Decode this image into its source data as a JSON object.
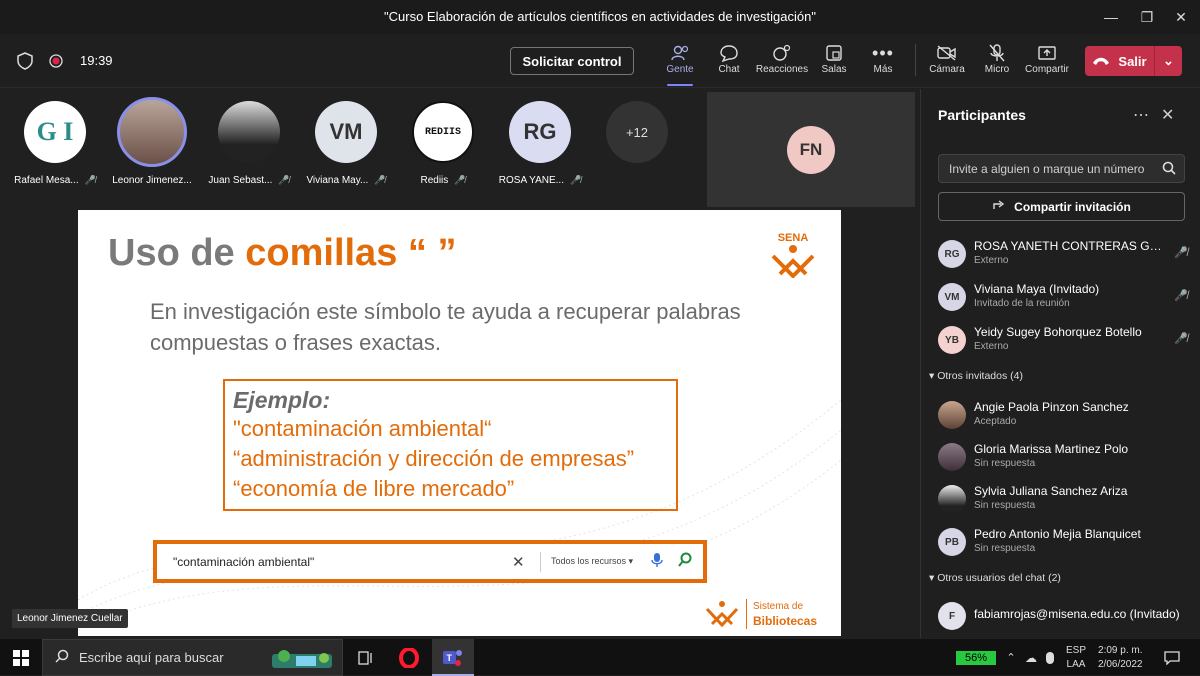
{
  "window": {
    "title": "\"Curso Elaboración de artículos científicos en actividades de investigación\""
  },
  "toolbar": {
    "time": "19:39",
    "request_control": "Solicitar control",
    "items": [
      {
        "label": "Gente"
      },
      {
        "label": "Chat"
      },
      {
        "label": "Reacciones"
      },
      {
        "label": "Salas"
      },
      {
        "label": "Más"
      },
      {
        "label": "Cámara"
      },
      {
        "label": "Micro"
      },
      {
        "label": "Compartir"
      }
    ],
    "leave": "Salir"
  },
  "participants_strip": [
    {
      "name": "Rafael Mesa...",
      "initials": "G I"
    },
    {
      "name": "Leonor Jimenez...",
      "initials": ""
    },
    {
      "name": "Juan Sebast...",
      "initials": ""
    },
    {
      "name": "Viviana May...",
      "initials": "VM"
    },
    {
      "name": "Rediis",
      "initials": "REDIIS"
    },
    {
      "name": "ROSA YANE...",
      "initials": "RG"
    }
  ],
  "overflow_count": "+12",
  "fn_tile": {
    "initials": "FN"
  },
  "slide": {
    "title_plain": "Uso de ",
    "title_highlight": "comillas",
    "title_quotes": "“   ”",
    "body": "En investigación este símbolo te ayuda a recuperar palabras compuestas o frases exactas.",
    "example_head": "Ejemplo:",
    "examples": [
      "\"contaminación ambiental“",
      "“administración y dirección de empresas”",
      "“economía de libre mercado”"
    ],
    "search_query": "\"contaminación ambiental\"",
    "search_scope": "Todos los recursos",
    "logo_text": "SENA",
    "footer_line1": "Sistema de",
    "footer_line2": "Bibliotecas"
  },
  "presenter_tag": "Leonor Jimenez Cuellar",
  "panel": {
    "title": "Participantes",
    "invite_placeholder": "Invite a alguien o marque un número",
    "share_invite": "Compartir invitación",
    "people": [
      {
        "initials": "RG",
        "name": "ROSA YANETH CONTRERAS GO...",
        "status": "Externo"
      },
      {
        "initials": "VM",
        "name": "Viviana Maya (Invitado)",
        "status": "Invitado de la reunión"
      },
      {
        "initials": "YB",
        "name": "Yeidy Sugey Bohorquez Botello",
        "status": "Externo"
      }
    ],
    "invited_section": "Otros invitados (4)",
    "invited": [
      {
        "initials": "",
        "name": "Angie Paola Pinzon Sanchez",
        "status": "Aceptado"
      },
      {
        "initials": "",
        "name": "Gloria Marissa Martinez Polo",
        "status": "Sin respuesta"
      },
      {
        "initials": "",
        "name": "Sylvia Juliana Sanchez Ariza",
        "status": "Sin respuesta"
      },
      {
        "initials": "PB",
        "name": "Pedro Antonio Mejia Blanquicet",
        "status": "Sin respuesta"
      }
    ],
    "chat_section": "Otros usuarios del chat (2)",
    "chat_users": [
      {
        "initials": "F",
        "name": "fabiamrojas@misena.edu.co (Invitado)"
      }
    ]
  },
  "taskbar": {
    "search_placeholder": "Escribe aquí para buscar",
    "battery": "56%",
    "lang1": "ESP",
    "lang2": "LAA",
    "clock_time": "2:09 p. m.",
    "clock_date": "2/06/2022"
  },
  "colors": {
    "accent": "#e36c0a",
    "leave": "#c4314b",
    "teams": "#7f85f5"
  }
}
